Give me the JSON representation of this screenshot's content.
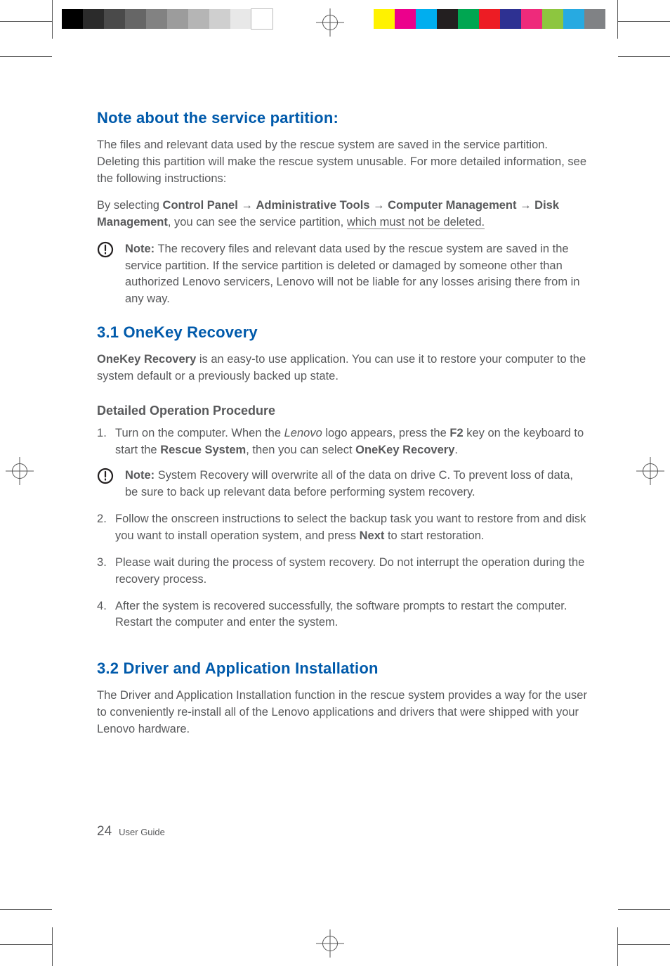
{
  "headings": {
    "h1": "Note about the service partition:",
    "h2": "3.1 OneKey Recovery",
    "h3": "3.2 Driver and Application Installation",
    "sub1": "Detailed Operation Procedure"
  },
  "body": {
    "p1": "The files and relevant data used by the rescue system are saved in the service partition. Deleting this partition will make the rescue system unusable. For more detailed information, see the following instructions:",
    "p2_pre": "By selecting ",
    "p2_b1": "Control Panel",
    "p2_arr": " → ",
    "p2_b2": "Administrative Tools",
    "p2_b3": "Computer Management",
    "p2_b4": "Disk Management",
    "p2_mid": ", you can see the service partition, ",
    "p2_und": "which must not be deleted.",
    "note1_label": "Note:",
    "note1": " The recovery files and relevant data used by the rescue system are saved in the service partition. If the service partition is deleted or damaged by someone other than authorized Lenovo servicers, Lenovo will not be liable for any losses arising there from in any way.",
    "okr_b": "OneKey Recovery",
    "okr_rest": " is an easy-to use application. You can use it to restore your computer to the system default or a previously backed up state.",
    "s1_a": "Turn on the computer. When the ",
    "s1_i": "Lenovo",
    "s1_b": " logo appears, press the ",
    "s1_f2": "F2",
    "s1_c": " key on the keyboard to start the ",
    "s1_rs": "Rescue System",
    "s1_d": ", then you can select ",
    "s1_ok": "OneKey Recovery",
    "s1_e": ".",
    "note2_label": "Note:",
    "note2": " System Recovery will overwrite all of the data on drive C. To prevent loss of data, be sure to back up relevant data before performing system recovery.",
    "s2_a": "Follow the onscreen instructions to select the backup task you want to restore from and disk you want to install operation system, and press ",
    "s2_b": "Next",
    "s2_c": " to start restoration.",
    "s3": "Please wait during the process of system recovery. Do not interrupt the operation during the recovery process.",
    "s4": "After the system is recovered successfully, the software prompts to restart the computer. Restart the computer and enter the system.",
    "p_drv": "The Driver and Application Installation function in the rescue system provides a way for the user to conveniently re-install all of the Lenovo applications and drivers that were shipped with your Lenovo hardware."
  },
  "footer": {
    "page": "24",
    "title": "User Guide"
  },
  "reg_colors": {
    "left": [
      "#000000",
      "#2b2b2b",
      "#4a4a4a",
      "#666666",
      "#828282",
      "#9c9c9c",
      "#b5b5b5",
      "#cfcfcf",
      "#e8e8e8",
      "#ffffff"
    ],
    "right": [
      "#fff200",
      "#ec008c",
      "#00aeef",
      "#231f20",
      "#00a651",
      "#ed1c24",
      "#2e3192",
      "#ee2a7b",
      "#8dc63f",
      "#27aae1",
      "#808285"
    ]
  }
}
